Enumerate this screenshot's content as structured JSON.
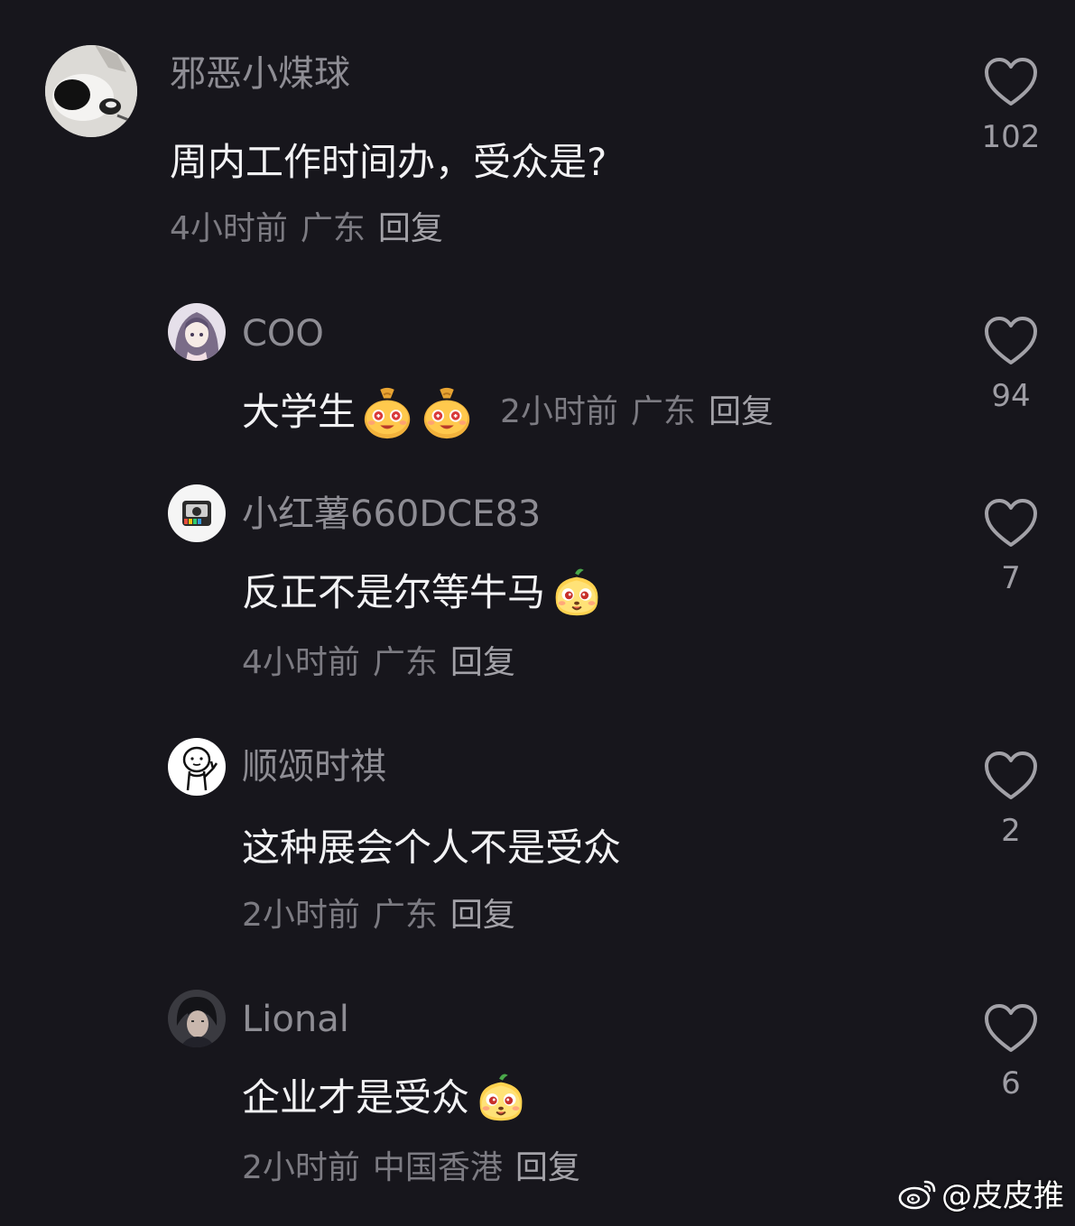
{
  "comments": [
    {
      "username": "邪恶小煤球",
      "text": "周内工作时间办，受众是?",
      "time": "4小时前",
      "location": "广东",
      "reply": "回复",
      "likes": "102"
    },
    {
      "username": "COO",
      "text": "大学生",
      "time": "2小时前",
      "location": "广东",
      "reply": "回复",
      "likes": "94"
    },
    {
      "username": "小红薯660DCE83",
      "text": "反正不是尔等牛马",
      "time": "4小时前",
      "location": "广东",
      "reply": "回复",
      "likes": "7"
    },
    {
      "username": "顺颂时祺",
      "text": "这种展会个人不是受众",
      "time": "2小时前",
      "location": "广东",
      "reply": "回复",
      "likes": "2"
    },
    {
      "username": "Lional",
      "text": "企业才是受众",
      "time": "2小时前",
      "location": "中国香港",
      "reply": "回复",
      "likes": "6"
    }
  ],
  "watermark": {
    "text": "@皮皮推",
    "icon": "weibo-icon"
  },
  "colors": {
    "background": "#17161c",
    "username": "#8e8d94",
    "body_text": "#f2f2f4",
    "meta": "#7c7b82"
  }
}
